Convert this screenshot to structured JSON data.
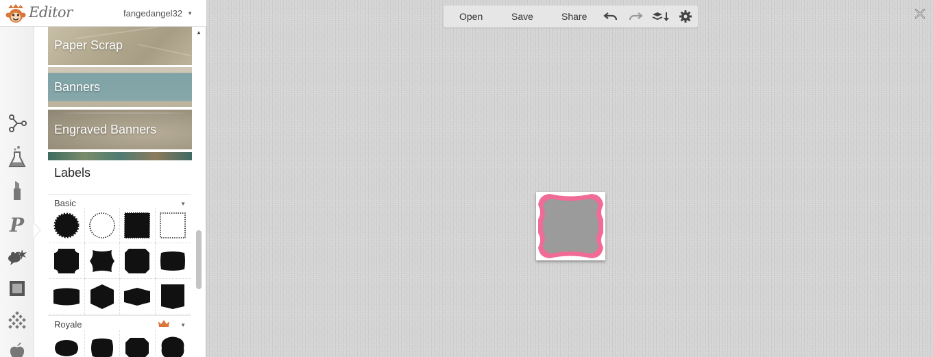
{
  "app": {
    "logo_text": "Editor",
    "username": "fangedangel32"
  },
  "tools": [
    {
      "name": "effects",
      "icon": "nodes-icon"
    },
    {
      "name": "touch-up",
      "icon": "flask-icon"
    },
    {
      "name": "lipstick",
      "icon": "lipstick-icon"
    },
    {
      "name": "text",
      "icon": "text-p-icon"
    },
    {
      "name": "overlays",
      "icon": "speech-bubbles-icon"
    },
    {
      "name": "frames",
      "icon": "frame-icon"
    },
    {
      "name": "textures",
      "icon": "texture-icon"
    },
    {
      "name": "themes",
      "icon": "apple-icon"
    }
  ],
  "categories": [
    {
      "label": "Paper Scrap"
    },
    {
      "label": "Banners"
    },
    {
      "label": "Engraved Banners"
    }
  ],
  "labels_panel": {
    "title": "Labels",
    "sections": [
      {
        "name": "Basic",
        "shapes": [
          "scallop-circle",
          "dotted-circle",
          "stamp-square",
          "dotted-square",
          "notched-cross",
          "fancy-bracket",
          "chamfer-tall",
          "bowed-rect",
          "wide-banner",
          "hexagon",
          "wide-hexagon",
          "shield"
        ]
      },
      {
        "name": "Royale",
        "premium": true,
        "shapes": [
          "royal-oval",
          "royal-bracket",
          "royal-octagon",
          "royal-scallop"
        ]
      }
    ]
  },
  "toolbar": {
    "open_label": "Open",
    "save_label": "Save",
    "share_label": "Share"
  },
  "canvas": {
    "label_fill": "#9b9b9b",
    "label_border": "#f06b95"
  },
  "colors": {
    "accent": "#d9773a",
    "banner_teal": "#7fa2a5"
  }
}
